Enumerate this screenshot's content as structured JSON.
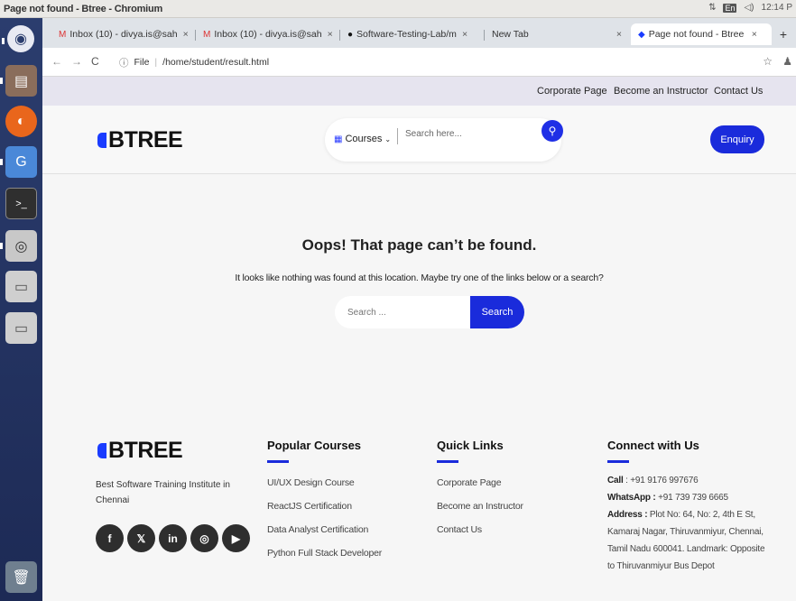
{
  "system": {
    "window_title": "Page not found - Btree - Chromium",
    "clock": "12:14 P",
    "keyboard_layout": "En"
  },
  "launcher": {
    "items": [
      "chromium-icon",
      "files-icon",
      "firefox-icon",
      "chromium-icon",
      "terminal-icon",
      "camera-icon",
      "drive-icon",
      "drive-icon",
      "trash-icon"
    ]
  },
  "browser": {
    "tabs": [
      {
        "label": "Inbox (10) - divya.is@sah",
        "icon": "gmail-icon"
      },
      {
        "label": "Inbox (10) - divya.is@sah",
        "icon": "gmail-icon"
      },
      {
        "label": "Software-Testing-Lab/m",
        "icon": "github-icon"
      },
      {
        "label": "New Tab",
        "icon": ""
      },
      {
        "label": "Page not found - Btree",
        "icon": "btree-icon"
      }
    ],
    "url_scheme": "File",
    "url": "/home/student/result.html"
  },
  "page": {
    "top_links": [
      "Corporate Page",
      "Become an Instructor",
      "Contact Us"
    ],
    "logo_text": "BTREE",
    "header": {
      "courses_label": "Courses",
      "search_placeholder": "Search here...",
      "enquiry_label": "Enquiry"
    },
    "error": {
      "title": "Oops! That page can’t be found.",
      "description": "It looks like nothing was found at this location. Maybe try one of the links below or a search?",
      "search_placeholder": "Search ...",
      "search_button": "Search"
    },
    "footer": {
      "description": "Best Software Training Institute in Chennai",
      "social": [
        "f",
        "𝕏",
        "in",
        "◎",
        "▶"
      ],
      "popular_courses": {
        "heading": "Popular Courses",
        "items": [
          "UI/UX Design Course",
          "ReactJS Certification",
          "Data Analyst Certification",
          "Python Full Stack Developer"
        ]
      },
      "quick_links": {
        "heading": "Quick Links",
        "items": [
          "Corporate Page",
          "Become an Instructor",
          "Contact Us"
        ]
      },
      "connect": {
        "heading": "Connect with Us",
        "call_label": "Call",
        "call_value": ": +91 9176 997676",
        "whatsapp_label": "WhatsApp :",
        "whatsapp_value": "+91 739 739 6665",
        "address_label": "Address :",
        "address_value": "Plot No: 64, No: 2, 4th E St, Kamaraj Nagar, Thiruvanmiyur, Chennai, Tamil Nadu 600041. Landmark: Opposite to Thiruvanmiyur Bus Depot"
      }
    },
    "colors": {
      "accent": "#1a2bdb",
      "launcher": "#22315f"
    }
  }
}
